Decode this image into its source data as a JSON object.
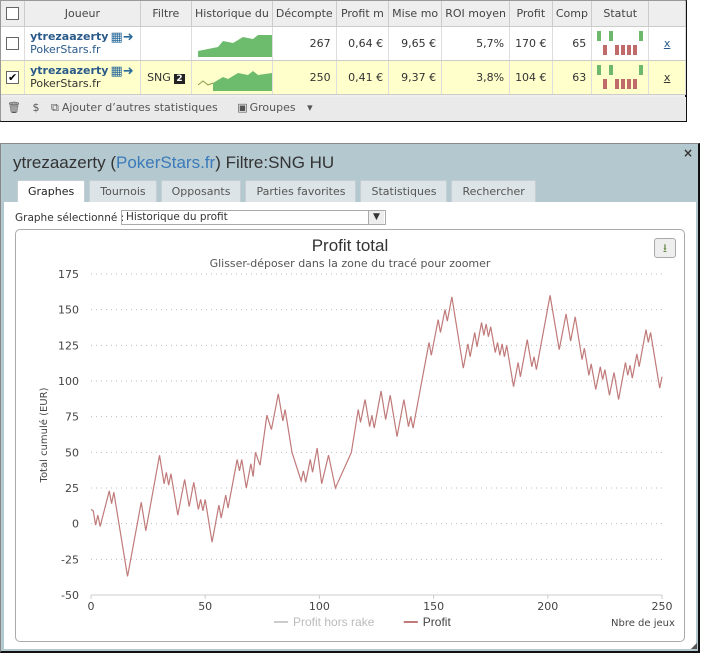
{
  "table": {
    "headers": [
      "Joueur",
      "Filtre",
      "Historique du",
      "Décompte",
      "Profit m",
      "Mise mo",
      "ROI moyen",
      "Profit",
      "Comp",
      "Statut"
    ],
    "rows": [
      {
        "checked": false,
        "player": "ytrezaazerty",
        "site": "PokerStars.fr",
        "filter": "",
        "filter_badge": "",
        "count": "267",
        "avg_profit": "0,64 €",
        "avg_stake": "9,65 €",
        "roi": "5,7%",
        "profit": "170 €",
        "comp": "65",
        "remove": "x"
      },
      {
        "checked": true,
        "player": "ytrezaazerty",
        "site": "PokerStars.fr",
        "filter": "SNG",
        "filter_badge": "2",
        "count": "250",
        "avg_profit": "0,41 €",
        "avg_stake": "9,37 €",
        "roi": "3,8%",
        "profit": "104 €",
        "comp": "63",
        "remove": "x"
      }
    ],
    "toolbar": {
      "add_stats": "Ajouter d’autres statistiques",
      "groups": "Groupes"
    }
  },
  "dialog": {
    "player": "ytrezaazerty",
    "open_paren": " (",
    "site": "PokerStars.fr",
    "filter": ") Filtre:SNG HU",
    "close": "×",
    "tabs": [
      "Graphes",
      "Tournois",
      "Opposants",
      "Parties favorites",
      "Statistiques",
      "Rechercher"
    ],
    "graph_label": "Graphe sélectionné :",
    "graph_value": "Historique du profit"
  },
  "chart_data": {
    "type": "line",
    "title": "Profit total",
    "subtitle": "Glisser-déposer dans la zone du tracé pour zoomer",
    "xlabel": "Nbre de jeux",
    "ylabel": "Total cumulé (EUR)",
    "xlim": [
      0,
      250
    ],
    "ylim": [
      -50,
      175
    ],
    "xticks": [
      0,
      50,
      100,
      150,
      200,
      250
    ],
    "yticks": [
      -50,
      -25,
      0,
      25,
      50,
      75,
      100,
      125,
      150,
      175
    ],
    "legend": [
      {
        "name": "Profit hors rake",
        "color": "#cccccc"
      },
      {
        "name": "Profit",
        "color": "#c07a7a"
      }
    ],
    "series": [
      {
        "name": "Profit",
        "color": "#c07a7a",
        "points": [
          [
            0,
            10
          ],
          [
            1,
            9
          ],
          [
            2,
            -1
          ],
          [
            3,
            6
          ],
          [
            4,
            -2
          ],
          [
            8,
            23
          ],
          [
            9,
            14
          ],
          [
            10,
            22
          ],
          [
            16,
            -37
          ],
          [
            22,
            15
          ],
          [
            24,
            -5
          ],
          [
            30,
            48
          ],
          [
            32,
            28
          ],
          [
            33,
            36
          ],
          [
            34,
            27
          ],
          [
            35,
            35
          ],
          [
            38,
            6
          ],
          [
            41,
            31
          ],
          [
            43,
            12
          ],
          [
            45,
            29
          ],
          [
            47,
            10
          ],
          [
            48,
            17
          ],
          [
            49,
            9
          ],
          [
            50,
            17
          ],
          [
            53,
            -13
          ],
          [
            56,
            13
          ],
          [
            57,
            4
          ],
          [
            59,
            20
          ],
          [
            60,
            11
          ],
          [
            64,
            45
          ],
          [
            65,
            37
          ],
          [
            66,
            45
          ],
          [
            68,
            25
          ],
          [
            70,
            42
          ],
          [
            71,
            33
          ],
          [
            72,
            50
          ],
          [
            74,
            41
          ],
          [
            77,
            76
          ],
          [
            79,
            66
          ],
          [
            82,
            91
          ],
          [
            84,
            72
          ],
          [
            85,
            80
          ],
          [
            88,
            50
          ],
          [
            92,
            30
          ],
          [
            93,
            37
          ],
          [
            94,
            29
          ],
          [
            96,
            45
          ],
          [
            97,
            36
          ],
          [
            99,
            53
          ],
          [
            101,
            28
          ],
          [
            104,
            48
          ],
          [
            107,
            25
          ],
          [
            114,
            50
          ],
          [
            117,
            80
          ],
          [
            118,
            71
          ],
          [
            120,
            87
          ],
          [
            122,
            68
          ],
          [
            123,
            76
          ],
          [
            124,
            67
          ],
          [
            127,
            93
          ],
          [
            129,
            73
          ],
          [
            131,
            90
          ],
          [
            134,
            61
          ],
          [
            137,
            87
          ],
          [
            139,
            68
          ],
          [
            140,
            75
          ],
          [
            141,
            67
          ],
          [
            148,
            127
          ],
          [
            149,
            118
          ],
          [
            152,
            143
          ],
          [
            153,
            134
          ],
          [
            155,
            150
          ],
          [
            156,
            142
          ],
          [
            158,
            159
          ],
          [
            163,
            109
          ],
          [
            165,
            126
          ],
          [
            166,
            117
          ],
          [
            168,
            134
          ],
          [
            169,
            124
          ],
          [
            171,
            141
          ],
          [
            172,
            132
          ],
          [
            173,
            140
          ],
          [
            174,
            131
          ],
          [
            175,
            138
          ],
          [
            177,
            120
          ],
          [
            178,
            127
          ],
          [
            179,
            118
          ],
          [
            180,
            126
          ],
          [
            181,
            117
          ],
          [
            182,
            125
          ],
          [
            185,
            96
          ],
          [
            187,
            113
          ],
          [
            188,
            103
          ],
          [
            191,
            129
          ],
          [
            193,
            110
          ],
          [
            194,
            117
          ],
          [
            195,
            108
          ],
          [
            201,
            160
          ],
          [
            205,
            122
          ],
          [
            208,
            147
          ],
          [
            210,
            128
          ],
          [
            212,
            145
          ],
          [
            215,
            115
          ],
          [
            216,
            123
          ],
          [
            218,
            104
          ],
          [
            219,
            112
          ],
          [
            221,
            94
          ],
          [
            223,
            110
          ],
          [
            224,
            101
          ],
          [
            225,
            108
          ],
          [
            227,
            90
          ],
          [
            229,
            106
          ],
          [
            231,
            87
          ],
          [
            234,
            113
          ],
          [
            235,
            104
          ],
          [
            236,
            111
          ],
          [
            237,
            102
          ],
          [
            239,
            119
          ],
          [
            240,
            110
          ],
          [
            243,
            136
          ],
          [
            244,
            127
          ],
          [
            245,
            134
          ],
          [
            249,
            95
          ],
          [
            250,
            103
          ]
        ]
      }
    ]
  }
}
